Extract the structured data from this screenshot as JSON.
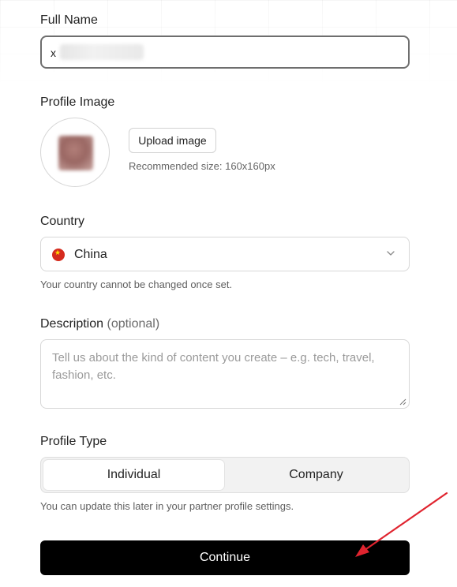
{
  "form": {
    "full_name": {
      "label": "Full Name",
      "caret": "x"
    },
    "profile_image": {
      "label": "Profile Image",
      "upload_button": "Upload image",
      "recommendation": "Recommended size: 160x160px"
    },
    "country": {
      "label": "Country",
      "selected": "China",
      "flag_icon": "china-flag-icon",
      "help": "Your country cannot be changed once set."
    },
    "description": {
      "label": "Description",
      "optional": "(optional)",
      "placeholder": "Tell us about the kind of content you create – e.g. tech, travel, fashion, etc."
    },
    "profile_type": {
      "label": "Profile Type",
      "options": [
        "Individual",
        "Company"
      ],
      "selected": "Individual",
      "help": "You can update this later in your partner profile settings."
    },
    "continue_label": "Continue"
  },
  "annotation": {
    "arrow_color": "#e0242f"
  }
}
